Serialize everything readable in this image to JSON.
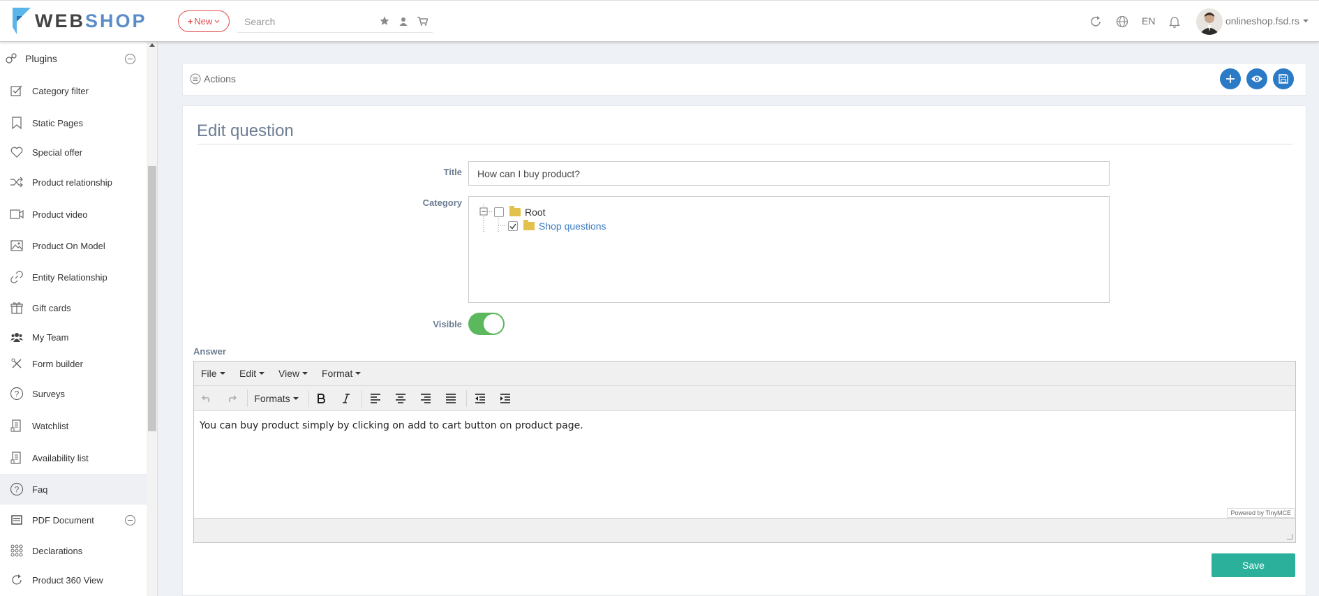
{
  "header": {
    "logo": {
      "part1": "WEB",
      "part2": "SHOP"
    },
    "new_label": "New",
    "search_placeholder": "Search",
    "language": "EN",
    "account": "onlineshop.fsd.rs"
  },
  "sidebar": {
    "items": [
      {
        "label": "Plugins",
        "icon": "plugin-icon",
        "collapsible": true
      },
      {
        "label": "Category filter",
        "icon": "checkbox-icon"
      },
      {
        "label": "Static Pages",
        "icon": "bookmark-icon"
      },
      {
        "label": "Special offer",
        "icon": "heart-icon"
      },
      {
        "label": "Product relationship",
        "icon": "shuffle-icon"
      },
      {
        "label": "Product video",
        "icon": "video-icon"
      },
      {
        "label": "Product On Model",
        "icon": "image-icon"
      },
      {
        "label": "Entity Relationship",
        "icon": "link-icon"
      },
      {
        "label": "Gift cards",
        "icon": "gift-icon"
      },
      {
        "label": "My Team",
        "icon": "team-icon"
      },
      {
        "label": "Form builder",
        "icon": "tools-icon"
      },
      {
        "label": "Surveys",
        "icon": "question-icon"
      },
      {
        "label": "Watchlist",
        "icon": "watchlist-icon"
      },
      {
        "label": "Availability list",
        "icon": "availability-icon"
      },
      {
        "label": "Faq",
        "icon": "question-icon",
        "active": true
      },
      {
        "label": "PDF Document",
        "icon": "pdf-icon",
        "collapsible": true
      },
      {
        "label": "Declarations",
        "icon": "grid-icon"
      },
      {
        "label": "Product 360 View",
        "icon": "rotate-icon"
      }
    ]
  },
  "actions": {
    "label": "Actions"
  },
  "form": {
    "heading": "Edit question",
    "title_label": "Title",
    "title_value": "How can I buy product?",
    "category_label": "Category",
    "tree": {
      "root": "Root",
      "child": "Shop questions",
      "child_checked": true
    },
    "visible_label": "Visible",
    "visible": true,
    "answer_label": "Answer"
  },
  "editor": {
    "menus": [
      "File",
      "Edit",
      "View",
      "Format"
    ],
    "formats_label": "Formats",
    "content": "You can buy product simply by clicking on add to cart button on product page.",
    "powered_by": "Powered by TinyMCE"
  },
  "save_label": "Save",
  "colors": {
    "accent": "#2a7ac6",
    "save": "#2bb09b",
    "toggle": "#5cb85c",
    "new": "#e14b4b"
  }
}
